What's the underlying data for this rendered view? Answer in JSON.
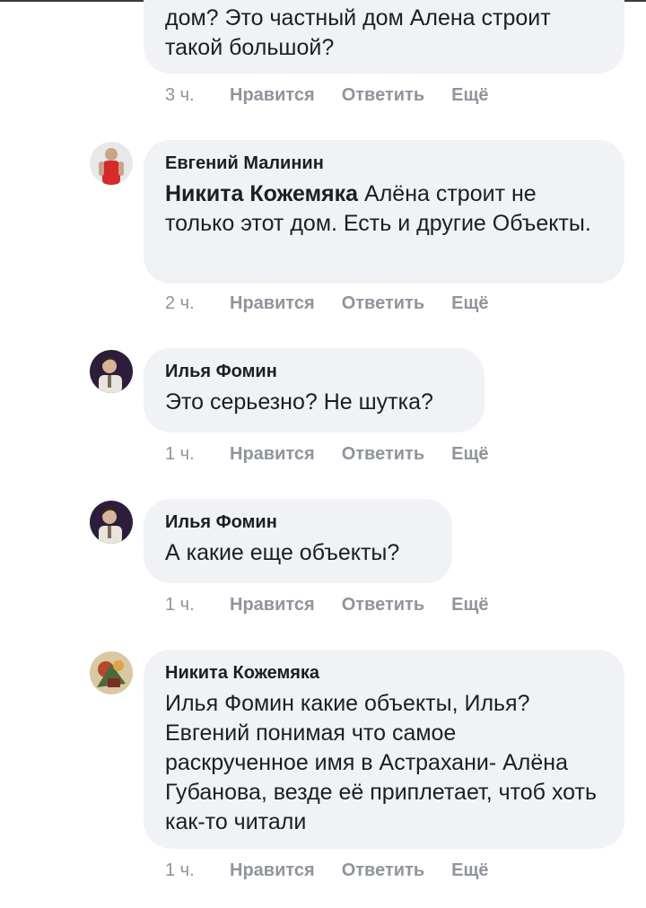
{
  "comments": [
    {
      "author": "",
      "mention": "",
      "text": "дом? Это частный дом Алена строит такой большой?",
      "time": "3 ч."
    },
    {
      "author": "Евгений Малинин",
      "mention": "Никита Кожемяка",
      "text": " Алёна строит не только этот дом. Есть и другие Объекты.",
      "time": "2 ч."
    },
    {
      "author": "Илья Фомин",
      "mention": "",
      "text": "Это серьезно? Не шутка?",
      "time": "1 ч."
    },
    {
      "author": "Илья Фомин",
      "mention": "",
      "text": "А какие еще объекты?",
      "time": "1 ч."
    },
    {
      "author": "Никита Кожемяка",
      "mention": "",
      "text": "Илья Фомин какие объекты, Илья? Евгений понимая что самое раскрученное имя в Астрахани- Алёна Губанова, везде её приплетает, чтоб хоть как-то читали",
      "time": "1 ч."
    }
  ],
  "actions": {
    "like": "Нравится",
    "reply": "Ответить",
    "more": "Ещё"
  },
  "colors": {
    "bubble": "#f0f2f5",
    "meta": "#8d949e",
    "text": "#1c1e21"
  }
}
